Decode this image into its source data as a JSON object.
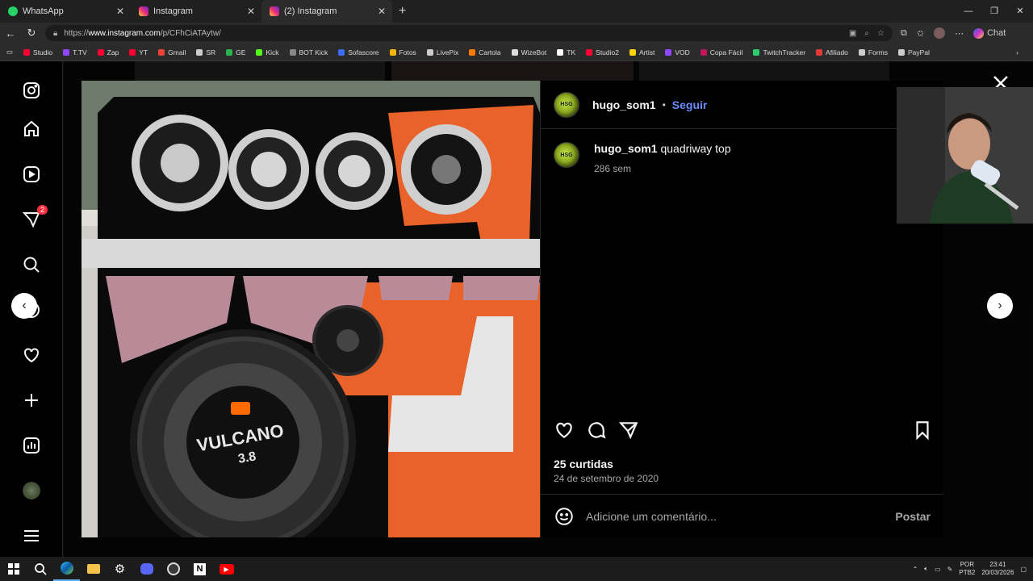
{
  "browser": {
    "tabs": [
      {
        "label": "WhatsApp",
        "icon": "whatsapp-icon",
        "color": "#25d366"
      },
      {
        "label": "Instagram",
        "icon": "instagram-icon",
        "color": "#e1306c"
      },
      {
        "label": "(2) Instagram",
        "icon": "instagram-icon",
        "color": "#e1306c",
        "active": true
      }
    ],
    "new_tab": "+",
    "url_prefix": "https://",
    "url_host": "www.instagram.com",
    "url_path": "/p/CFhCiATAytw/",
    "chat_label": "Chat"
  },
  "bookmarks": [
    {
      "label": "Studio",
      "color": "#ff0033"
    },
    {
      "label": "T.TV",
      "color": "#9146ff"
    },
    {
      "label": "Zap",
      "color": "#ff0033"
    },
    {
      "label": "YT",
      "color": "#ff0033"
    },
    {
      "label": "Gmail",
      "color": "#ea4335"
    },
    {
      "label": "SR",
      "color": "#cccccc"
    },
    {
      "label": "GE",
      "color": "#2bb24c"
    },
    {
      "label": "Kick",
      "color": "#53fc18"
    },
    {
      "label": "BOT Kick",
      "color": "#888888"
    },
    {
      "label": "Sofascore",
      "color": "#3a6cf4"
    },
    {
      "label": "Fotos",
      "color": "#f4b400"
    },
    {
      "label": "LivePix",
      "color": "#cccccc"
    },
    {
      "label": "Cartola",
      "color": "#f57c00"
    },
    {
      "label": "WizeBot",
      "color": "#dddddd"
    },
    {
      "label": "TK",
      "color": "#ffffff"
    },
    {
      "label": "Studio2",
      "color": "#ff0033"
    },
    {
      "label": "Artist",
      "color": "#ffd400"
    },
    {
      "label": "VOD",
      "color": "#9146ff"
    },
    {
      "label": "Copa Fácil",
      "color": "#c2185b"
    },
    {
      "label": "TwitchTracker",
      "color": "#2ecc71"
    },
    {
      "label": "Afiliado",
      "color": "#e53935"
    },
    {
      "label": "Forms",
      "color": "#cccccc"
    },
    {
      "label": "PayPal",
      "color": "#cccccc"
    }
  ],
  "sidebar": {
    "notification_count": "2"
  },
  "post": {
    "username": "hugo_som1",
    "separator": "•",
    "follow_label": "Seguir",
    "caption_text": "quadriway top",
    "caption_time": "286 sem",
    "likes": "25 curtidas",
    "date": "24 de setembro de 2020",
    "comment_placeholder": "Adicione um comentário...",
    "post_label": "Postar",
    "avatar_text": "HSG"
  },
  "taskbar": {
    "lang_top": "POR",
    "lang_bottom": "PTB2",
    "time": "23:41",
    "date": "20/03/2026"
  }
}
